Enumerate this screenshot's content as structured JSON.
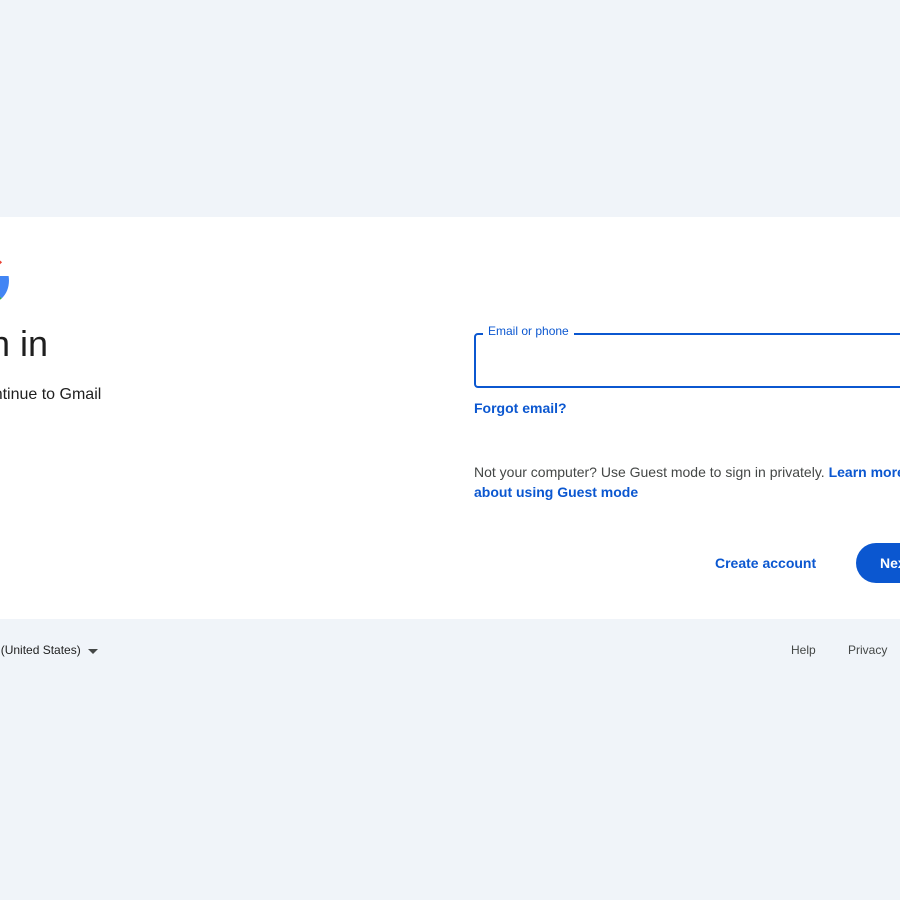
{
  "card": {
    "logo_icon": "google-g-icon",
    "heading": "Sign in",
    "subheading": "to continue to Gmail"
  },
  "email_field": {
    "label": "Email or phone",
    "value": ""
  },
  "forgot_email_link": "Forgot email?",
  "guest_mode": {
    "text": "Not your computer? Use Guest mode to sign in privately. ",
    "link": "Learn more about using Guest mode"
  },
  "actions": {
    "create_account": "Create account",
    "next": "Next"
  },
  "footer": {
    "language": "English (United States)",
    "help": "Help",
    "privacy": "Privacy"
  },
  "colors": {
    "background": "#f0f4f9",
    "card": "#ffffff",
    "accent": "#0b57d0"
  }
}
